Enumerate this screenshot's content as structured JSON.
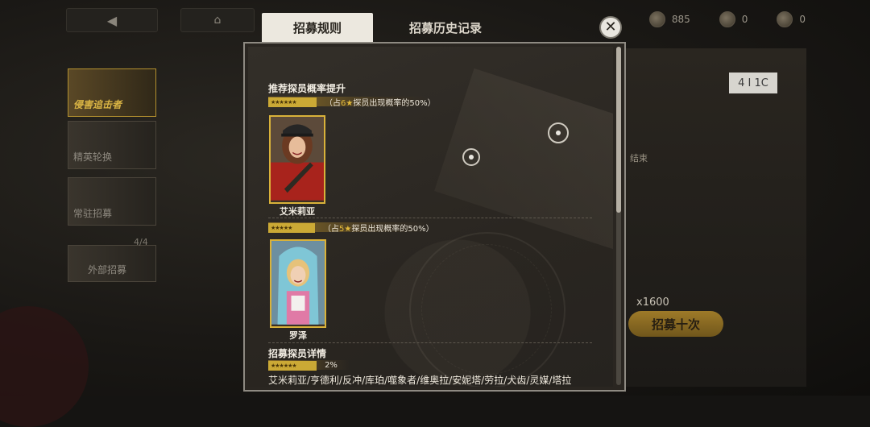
{
  "background": {
    "back_icon": "◀",
    "home_icon": "⌂",
    "sidebar": [
      {
        "label": "侵害追击者",
        "active": true
      },
      {
        "label": "精英轮换",
        "active": false
      },
      {
        "label": "常驻招募",
        "active": false
      },
      {
        "label": "外部招募",
        "active": false
      }
    ],
    "sidebar_count": "4/4",
    "currencies": [
      {
        "icon": "gem-icon",
        "value": "885"
      },
      {
        "icon": "ticket-icon",
        "value": "0"
      },
      {
        "icon": "coin-icon",
        "value": "0"
      }
    ],
    "right_badge": "4 I 1C",
    "right_end_label": "结束",
    "cost_text": "x1600",
    "recruit_ten_label": "招募十次"
  },
  "modal": {
    "tabs": [
      {
        "label": "招募规则",
        "active": true
      },
      {
        "label": "招募历史记录",
        "active": false
      }
    ],
    "close_icon": "✕",
    "boost_section": {
      "title": "推荐探员概率提升",
      "tiers": [
        {
          "stars": "★★★★★★",
          "text_prefix": "（占",
          "star_count": "6",
          "star_glyph": "★",
          "text_suffix": "探员出现概率的50%）",
          "character": "艾米莉亚"
        },
        {
          "stars": "★★★★★",
          "text_prefix": "（占",
          "star_count": "5",
          "star_glyph": "★",
          "text_suffix": "探员出现概率的50%）",
          "character": "罗泽"
        }
      ]
    },
    "detail_section": {
      "title": "招募探员详情",
      "stars": "★★★★★★",
      "rate": "2%",
      "rate_fraction": 0.02,
      "characters": "艾米莉亚/亨德利/反冲/库珀/噬象者/维奥拉/安妮塔/劳拉/犬齿/灵媒/塔拉"
    }
  }
}
